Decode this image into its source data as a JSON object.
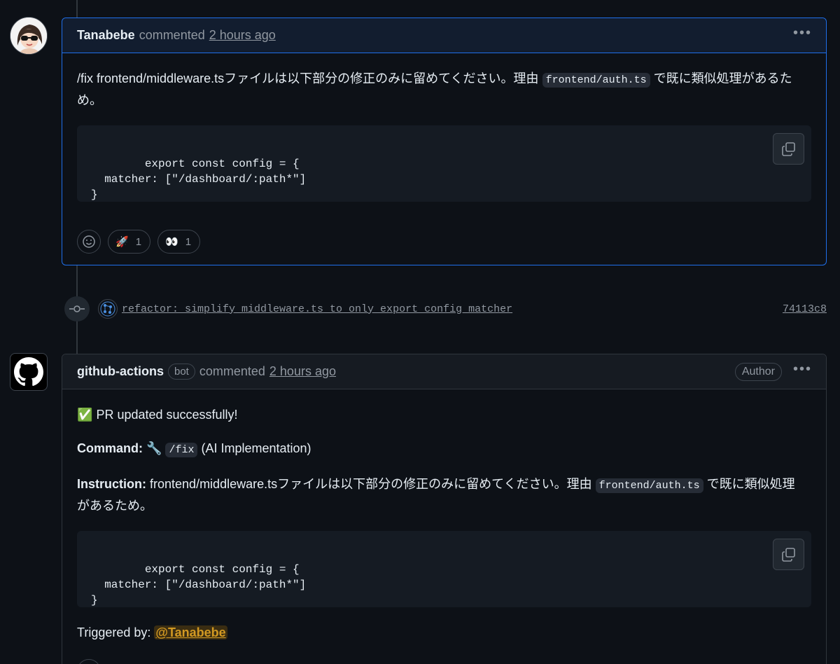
{
  "comment1": {
    "author": "Tanabebe",
    "action": "commented",
    "time": "2 hours ago",
    "body_line1": "/fix frontend/middleware.tsファイルは以下部分の修正のみに留めてください。理由",
    "body_code": "frontend/auth.ts",
    "body_line1_end": "で既に類似処理があるた",
    "body_line2": "め。",
    "code": "export const config = {\n  matcher: [\"/dashboard/:path*\"]\n}",
    "reactions": [
      {
        "emoji": "🚀",
        "count": "1"
      },
      {
        "emoji": "👀",
        "count": "1"
      }
    ]
  },
  "commit": {
    "message": "refactor: simplify middleware.ts to only export config matcher",
    "sha": "74113c8"
  },
  "comment2": {
    "author": "github-actions",
    "badge": "bot",
    "action": "commented",
    "time": "2 hours ago",
    "author_badge": "Author",
    "status_emoji": "✅",
    "status": "PR updated successfully!",
    "command_label": "Command:",
    "command_emoji": "🔧",
    "command_code": "/fix",
    "command_desc": "(AI Implementation)",
    "instruction_label": "Instruction:",
    "instruction_text": "frontend/middleware.tsファイルは以下部分の修正のみに留めてください。理由",
    "instruction_code": "frontend/auth.ts",
    "instruction_end": "で既に類似処理",
    "instruction_line2": "があるため。",
    "code": "export const config = {\n  matcher: [\"/dashboard/:path*\"]\n}",
    "triggered_label": "Triggered by:",
    "triggered_user": "@Tanabebe"
  }
}
